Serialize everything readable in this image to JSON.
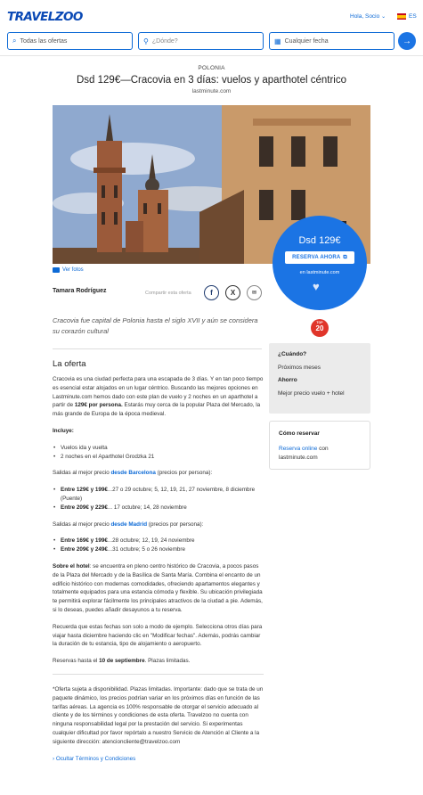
{
  "header": {
    "logo": "TRAVELZOO",
    "greeting": "Hola, Socio",
    "language": "ES"
  },
  "search": {
    "offers_label": "Todas las ofertas",
    "where_placeholder": "¿Dónde?",
    "date_label": "Cualquier fecha"
  },
  "deal": {
    "country": "POLONIA",
    "title": "Dsd 129€—Cracovia en 3 días: vuelos y aparthotel céntrico",
    "provider": "lastminute.com",
    "photos_link": "Ver fotos",
    "price": "Dsd 129€",
    "cta": "RESERVA AHORA",
    "cta_provider": "en lastminute.com",
    "author": "Tamara Rodríguez",
    "share_label": "Compartir esta oferta",
    "intro": "Cracovia fue capital de Polonia hasta el siglo XVII y aún se considera su corazón cultural",
    "top20": "20",
    "top20_small": "TOP"
  },
  "offer": {
    "heading": "La oferta",
    "p1_a": "Cracovia es una ciudad perfecta para una escapada de 3 días. Y en tan poco tiempo es esencial estar alojados en un lugar céntrico. Buscando las mejores opciones en Lastminute.com hemos dado con este plan de vuelo y 2 noches en un aparthotel a partir de ",
    "p1_b": "129€ por persona.",
    "p1_c": " Estarás muy cerca de la popular Plaza del Mercado, la más grande de Europa de la época medieval.",
    "includes_label": "Incluye:",
    "includes": [
      "Vuelos ida y vuelta",
      "2 noches en el Aparthotel Grodzka 21"
    ],
    "bcn_a": "Salidas al mejor precio ",
    "bcn_link": "desde Barcelona",
    "bcn_b": " (precios por persona):",
    "bcn_items": [
      {
        "price": "Entre 129€ y 199€",
        "dates": "...27 o 29 octubre; 5, 12, 19, 21, 27 noviembre, 8 diciembre (Puente)"
      },
      {
        "price": "Entre 209€ y 229€",
        "dates": "... 17 octubre; 14, 28 noviembre"
      }
    ],
    "mad_a": "Salidas al mejor precio ",
    "mad_link": "desde Madrid",
    "mad_b": " (precios por persona):",
    "mad_items": [
      {
        "price": "Entre 169€ y 199€",
        "dates": "...28 octubre; 12, 19, 24 noviembre"
      },
      {
        "price": "Entre 209€ y 249€",
        "dates": "...31 octubre; 5 o 26 noviembre"
      }
    ],
    "hotel_label": "Sobre el hotel",
    "hotel_text": ": se encuentra en pleno centro histórico de Cracovia, a pocos pasos de la Plaza del Mercado y de la Basílica de Santa María. Combina el encanto de un edificio histórico con modernas comodidades, ofreciendo apartamentos elegantes y totalmente equipados para una estancia cómoda y flexible. Su ubicación privilegiada te permitirá explorar fácilmente los principales atractivos de la ciudad a pie. Además, si lo deseas, puedes añadir desayunos a tu reserva.",
    "reminder": "Recuerda que estas fechas son solo a modo de ejemplo. Selecciona otros días para viajar hasta diciembre haciendo clic en \"Modificar fechas\". Además, podrás cambiar la duración de tu estancia, tipo de alojamiento o aeropuerto.",
    "deadline_a": "Reservas hasta el ",
    "deadline_b": "10 de septiembre",
    "deadline_c": ". Plazas limitadas.",
    "disclaimer": "*Oferta sujeta a disponibilidad. Plazas limitadas. Importante: dado que se trata de un paquete dinámico, los precios podrían variar en los próximos días en función de las tarifas aéreas. La agencia es 100% responsable de otorgar el servicio adecuado al cliente y de los términos y condiciones de esta oferta. Travelzoo no cuenta con ninguna responsabilidad legal por la prestación del servicio. Si experimentas cualquier dificultad por favor repórtalo a nuestro Servicio de Atención al Cliente a la siguiente dirección: atencioncliente@travelzoo.com",
    "terms_link": "› Ocultar Términos y Condiciones"
  },
  "sidebar": {
    "when_label": "¿Cuándo?",
    "when_value": "Próximos meses",
    "save_label": "Ahorro",
    "save_value": "Mejor precio vuelo + hotel",
    "how_label": "Cómo reservar",
    "how_link": "Reserva online",
    "how_text": " con lastminute.com"
  }
}
